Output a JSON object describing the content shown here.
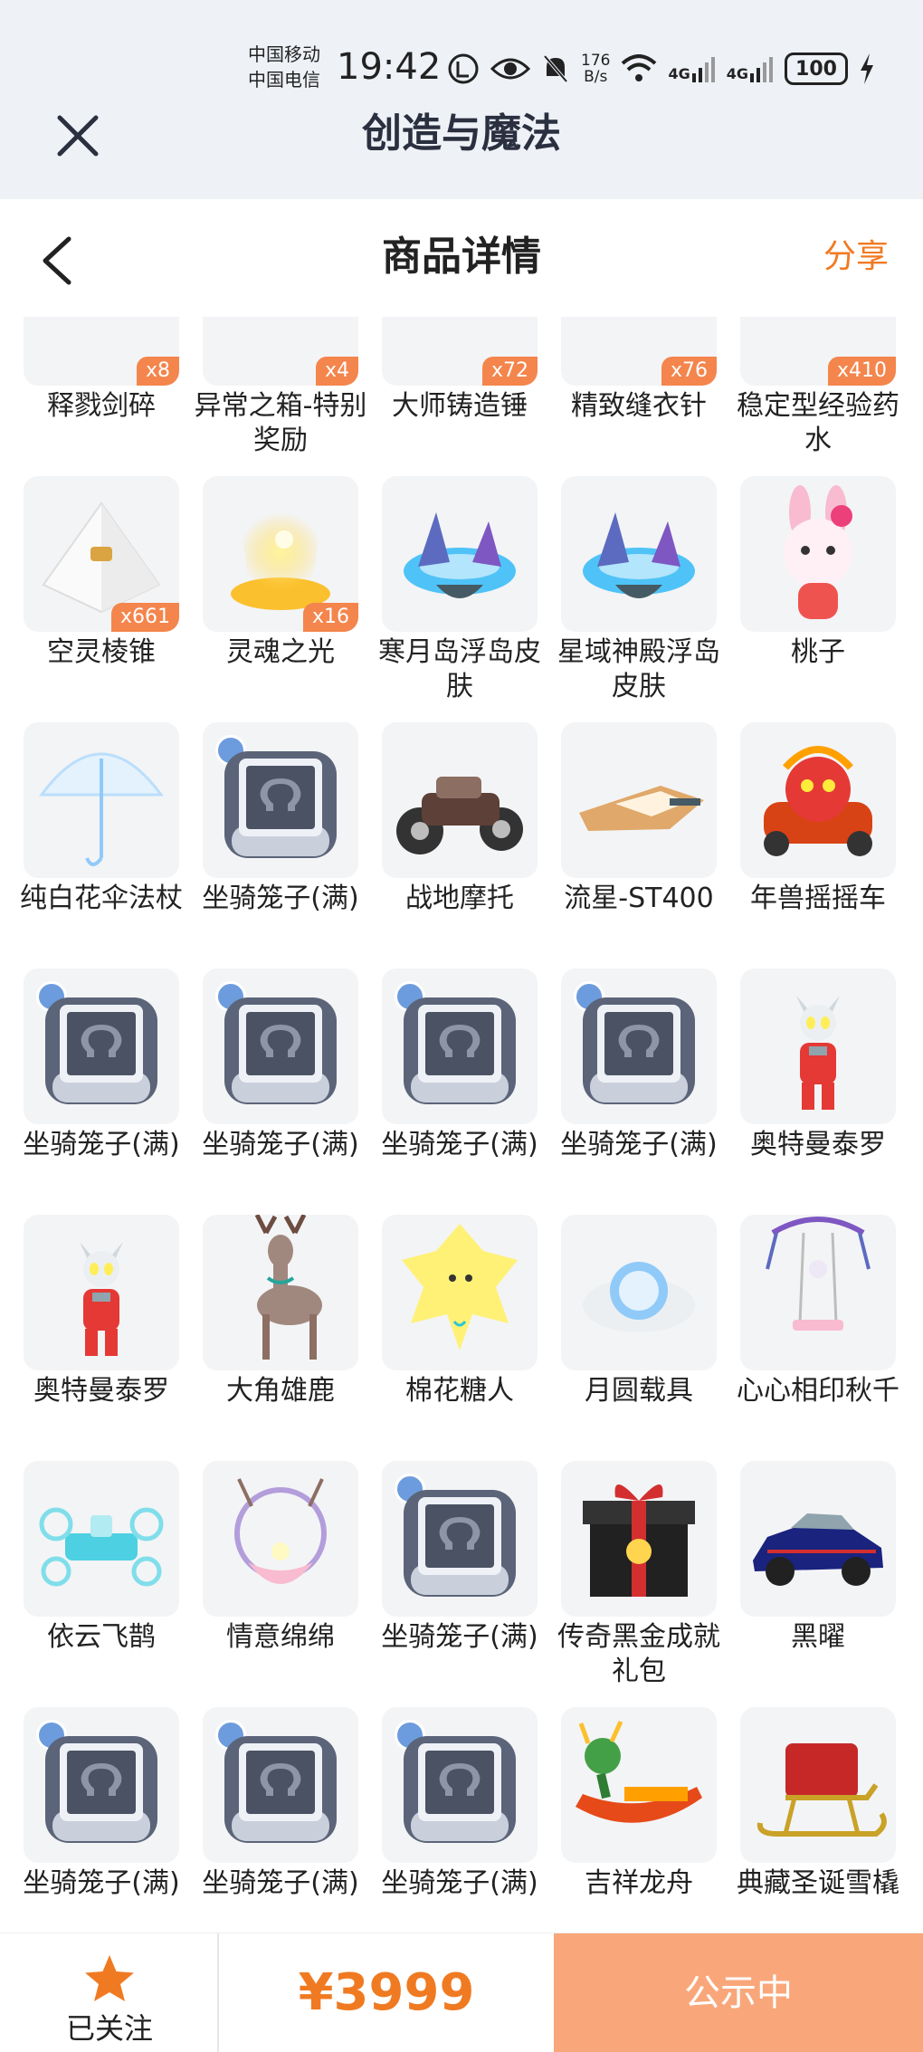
{
  "status_bar": {
    "carrier1": "中国移动",
    "carrier2": "中国电信",
    "time": "19:42",
    "net_speed_value": "176",
    "net_speed_unit": "B/s",
    "signal1": "4G",
    "signal2": "4G",
    "battery": "100"
  },
  "app_bar": {
    "title": "创造与魔法"
  },
  "header": {
    "title": "商品详情",
    "share": "分享"
  },
  "items": [
    [
      {
        "name": "释戮剑碎",
        "qty": "x8",
        "icon": "sword-fragment-icon"
      },
      {
        "name": "异常之箱-特别奖励",
        "qty": "x4",
        "icon": "chest-icon"
      },
      {
        "name": "大师铸造锤",
        "qty": "x72",
        "icon": "hammer-icon"
      },
      {
        "name": "精致缝衣针",
        "qty": "x76",
        "icon": "needle-icon"
      },
      {
        "name": "稳定型经验药水",
        "qty": "x410",
        "icon": "potion-icon"
      }
    ],
    [
      {
        "name": "空灵棱锥",
        "qty": "x661",
        "icon": "pyramid-icon"
      },
      {
        "name": "灵魂之光",
        "qty": "x16",
        "icon": "soul-light-icon"
      },
      {
        "name": "寒月岛浮岛皮肤",
        "qty": "",
        "icon": "floating-island-icon"
      },
      {
        "name": "星域神殿浮岛皮肤",
        "qty": "",
        "icon": "floating-island-icon"
      },
      {
        "name": "桃子",
        "qty": "",
        "icon": "pink-bunny-icon"
      }
    ],
    [
      {
        "name": "纯白花伞法杖",
        "qty": "",
        "icon": "umbrella-icon"
      },
      {
        "name": "坐骑笼子(满)",
        "qty": "",
        "icon": "cage-icon"
      },
      {
        "name": "战地摩托",
        "qty": "",
        "icon": "motorcycle-icon"
      },
      {
        "name": "流星-ST400",
        "qty": "",
        "icon": "hover-vehicle-icon"
      },
      {
        "name": "年兽摇摇车",
        "qty": "",
        "icon": "lion-car-icon"
      }
    ],
    [
      {
        "name": "坐骑笼子(满)",
        "qty": "",
        "icon": "cage-icon"
      },
      {
        "name": "坐骑笼子(满)",
        "qty": "",
        "icon": "cage-icon"
      },
      {
        "name": "坐骑笼子(满)",
        "qty": "",
        "icon": "cage-icon"
      },
      {
        "name": "坐骑笼子(满)",
        "qty": "",
        "icon": "cage-icon"
      },
      {
        "name": "奥特曼泰罗",
        "qty": "",
        "icon": "ultraman-icon"
      }
    ],
    [
      {
        "name": "奥特曼泰罗",
        "qty": "",
        "icon": "ultraman-icon"
      },
      {
        "name": "大角雄鹿",
        "qty": "",
        "icon": "deer-icon"
      },
      {
        "name": "棉花糖人",
        "qty": "",
        "icon": "cotton-candy-icon"
      },
      {
        "name": "月圆载具",
        "qty": "",
        "icon": "moon-vehicle-icon"
      },
      {
        "name": "心心相印秋千",
        "qty": "",
        "icon": "swing-icon"
      }
    ],
    [
      {
        "name": "依云飞鹊",
        "qty": "",
        "icon": "drone-icon"
      },
      {
        "name": "情意绵绵",
        "qty": "",
        "icon": "wreath-icon"
      },
      {
        "name": "坐骑笼子(满)",
        "qty": "",
        "icon": "cage-icon"
      },
      {
        "name": "传奇黑金成就礼包",
        "qty": "",
        "icon": "gift-box-icon"
      },
      {
        "name": "黑曜",
        "qty": "",
        "icon": "car-icon"
      }
    ],
    [
      {
        "name": "坐骑笼子(满)",
        "qty": "",
        "icon": "cage-icon"
      },
      {
        "name": "坐骑笼子(满)",
        "qty": "",
        "icon": "cage-icon"
      },
      {
        "name": "坐骑笼子(满)",
        "qty": "",
        "icon": "cage-icon"
      },
      {
        "name": "吉祥龙舟",
        "qty": "",
        "icon": "dragon-boat-icon"
      },
      {
        "name": "典藏圣诞雪橇",
        "qty": "",
        "icon": "sleigh-icon"
      }
    ]
  ],
  "bottom_bar": {
    "follow_label": "已关注",
    "price": "¥3999",
    "status_button": "公示中"
  },
  "colors": {
    "accent": "#f07a22",
    "status_button_bg": "#f9a77a",
    "qty_badge": "#f4854c",
    "topbar_bg": "#eef1f6"
  }
}
